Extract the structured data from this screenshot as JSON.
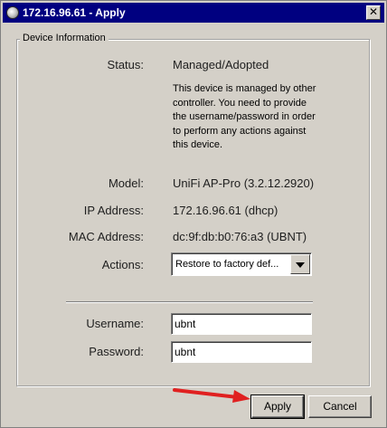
{
  "window": {
    "title": "172.16.96.61 - Apply",
    "close_glyph": "✕"
  },
  "group": {
    "legend": "Device Information"
  },
  "status": {
    "label": "Status:",
    "value": "Managed/Adopted",
    "note": "This device is managed by other controller. You need to provide the username/password in order to perform any actions against this device."
  },
  "model": {
    "label": "Model:",
    "value": "UniFi AP-Pro (3.2.12.2920)"
  },
  "ip": {
    "label": "IP Address:",
    "value": "172.16.96.61 (dhcp)"
  },
  "mac": {
    "label": "MAC Address:",
    "value": "dc:9f:db:b0:76:a3 (UBNT)"
  },
  "actions": {
    "label": "Actions:",
    "selected": "Restore to factory def..."
  },
  "username": {
    "label": "Username:",
    "value": "ubnt"
  },
  "password": {
    "label": "Password:",
    "value": "ubnt"
  },
  "buttons": {
    "apply": "Apply",
    "cancel": "Cancel"
  },
  "colors": {
    "titlebar": "#000080",
    "annotation_arrow": "#e02020",
    "background": "#d4d0c8"
  }
}
